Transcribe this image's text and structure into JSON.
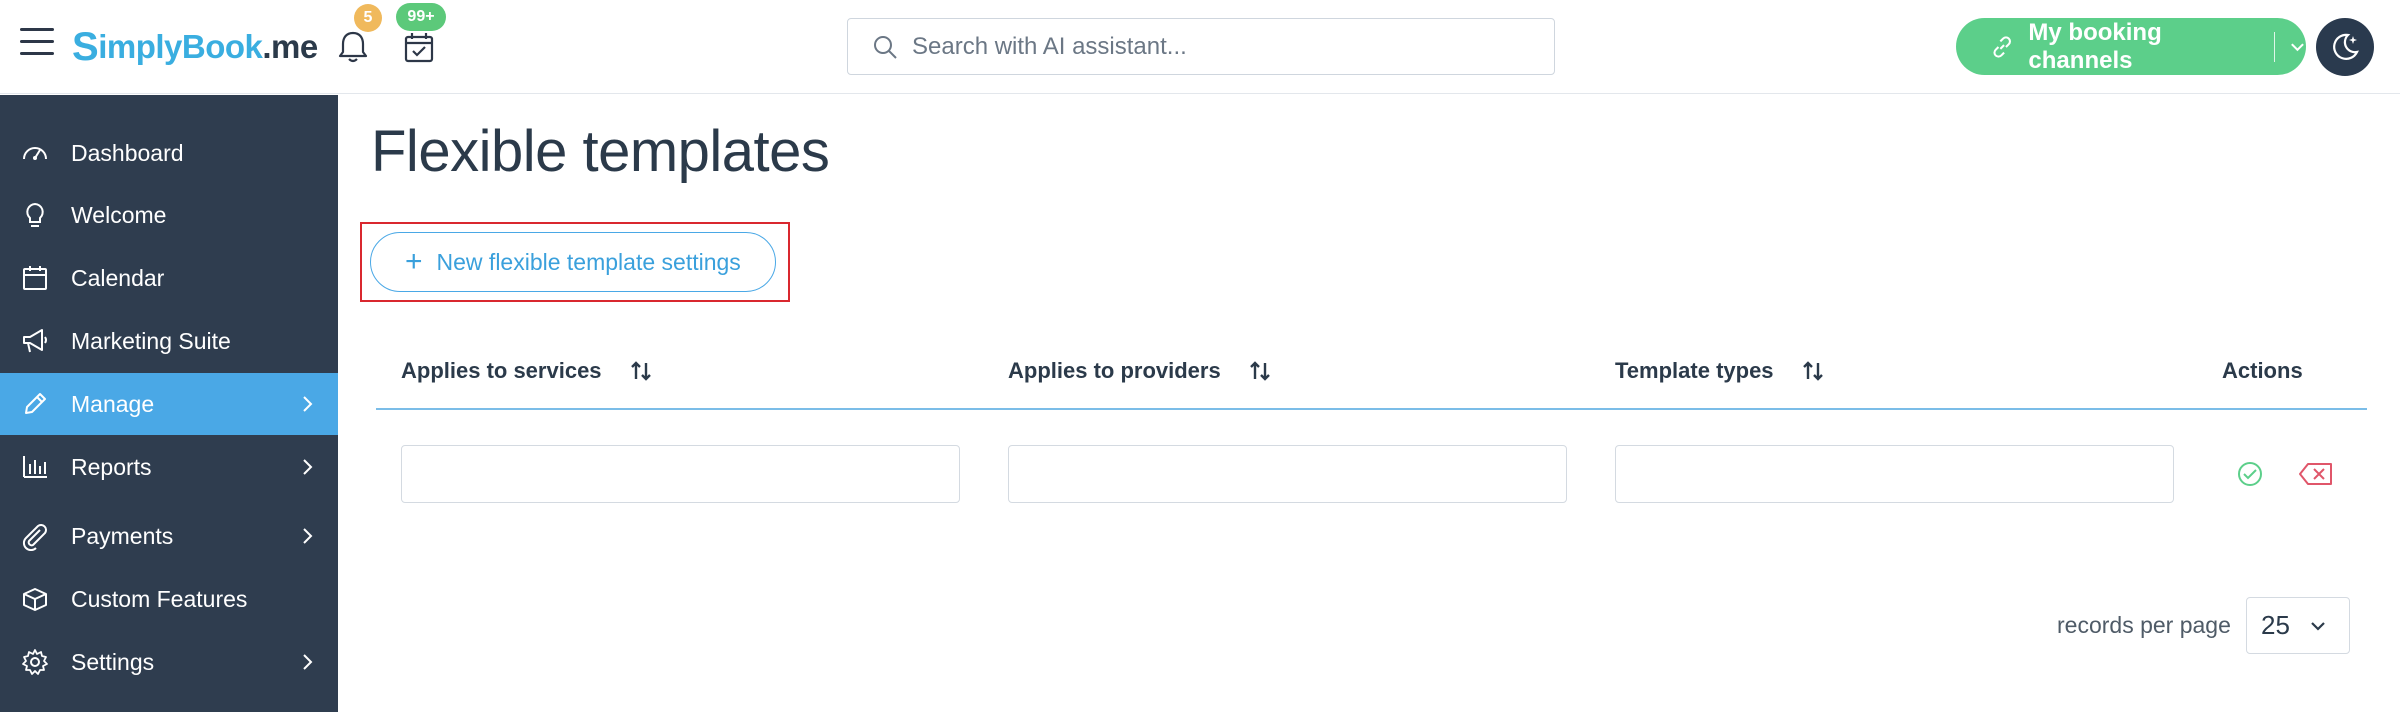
{
  "header": {
    "logo": {
      "s": "S",
      "simply": "implyBook",
      "me": ".me"
    },
    "notifications_count": "5",
    "bookings_count": "99+",
    "search_placeholder": "Search with AI assistant...",
    "booking_channels_label": "My booking channels"
  },
  "sidebar": {
    "items": [
      {
        "label": "Dashboard",
        "icon": "gauge-icon"
      },
      {
        "label": "Welcome",
        "icon": "lightbulb-icon"
      },
      {
        "label": "Calendar",
        "icon": "calendar-icon"
      },
      {
        "label": "Marketing Suite",
        "icon": "megaphone-icon"
      },
      {
        "label": "Manage",
        "icon": "pencil-icon",
        "active": true
      },
      {
        "label": "Reports",
        "icon": "bar-chart-icon"
      },
      {
        "label": "Payments",
        "icon": "paperclip-icon"
      },
      {
        "label": "Custom Features",
        "icon": "box-icon"
      },
      {
        "label": "Settings",
        "icon": "gear-icon"
      }
    ]
  },
  "main": {
    "title": "Flexible templates",
    "new_button_label": "New flexible template settings",
    "table": {
      "columns": [
        "Applies to services",
        "Applies to providers",
        "Template types",
        "Actions"
      ]
    },
    "pagination": {
      "label": "records per page",
      "value": "25"
    }
  },
  "colors": {
    "accent": "#4aa8e6",
    "sidebar_bg": "#2f3d4f",
    "channels_green": "#5ccf8a",
    "highlight_red": "#d9282f",
    "confirm_green": "#5ccf8a",
    "delete_red": "#e0566a"
  }
}
